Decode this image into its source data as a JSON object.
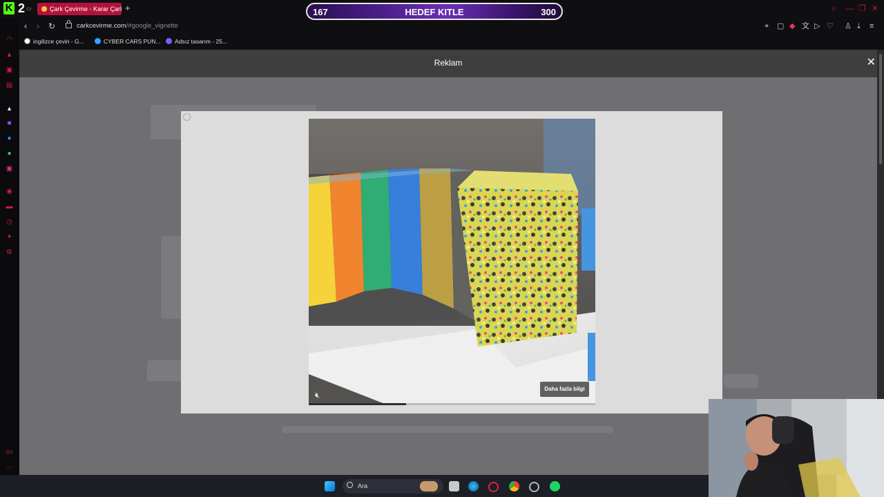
{
  "overlay": {
    "left_count": "167",
    "title": "HEDEF KITLE",
    "right_count": "300"
  },
  "browser": {
    "tab_title": "Çark Çevirme - Karar Çarkı",
    "url_host": "carkcevirme.com",
    "url_path": "/#google_vignette",
    "bookmarks": [
      "ingilizce çeviri - G...",
      "CYBER CARS PUN...",
      "Adsız tasarım - 25..."
    ],
    "brand_color": "#b3123b"
  },
  "ad": {
    "header": "Reklam",
    "cta": "Daha fazla bilgi",
    "progress": 0.34
  },
  "taskbar": {
    "search_placeholder": "Ara"
  }
}
